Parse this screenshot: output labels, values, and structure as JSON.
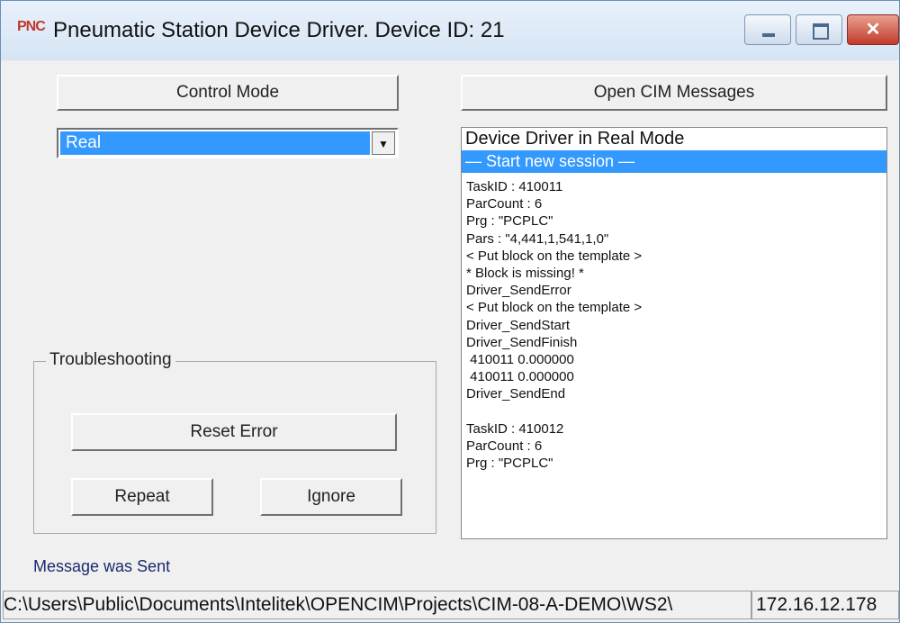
{
  "window": {
    "icon_text": "PNC",
    "title": "Pneumatic Station Device Driver.  Device ID: 21",
    "close_glyph": "✕"
  },
  "left": {
    "control_mode_label": "Control Mode",
    "mode_select": {
      "selected": "Real",
      "arrow": "▼"
    },
    "troubleshooting": {
      "title": "Troubleshooting",
      "reset_label": "Reset Error",
      "repeat_label": "Repeat",
      "ignore_label": "Ignore"
    },
    "status_message": "Message was Sent"
  },
  "right": {
    "open_messages_label": "Open CIM Messages",
    "messages": {
      "header": "Device Driver in Real Mode",
      "selected": "— Start new session —",
      "lines": [
        "TaskID : 410011",
        "ParCount : 6",
        "Prg : \"PCPLC\"",
        "Pars : \"4,441,1,541,1,0\"",
        "< Put block on the template >",
        "* Block is missing! *",
        "Driver_SendError",
        "< Put block on the template >",
        "Driver_SendStart",
        "Driver_SendFinish",
        " 410011 0.000000",
        " 410011 0.000000",
        "Driver_SendEnd",
        "",
        "TaskID : 410012",
        "ParCount : 6",
        "Prg : \"PCPLC\""
      ]
    }
  },
  "statusbar": {
    "path": "C:\\Users\\Public\\Documents\\Intelitek\\OPENCIM\\Projects\\CIM-08-A-DEMO\\WS2\\",
    "ip": "172.16.12.178"
  }
}
